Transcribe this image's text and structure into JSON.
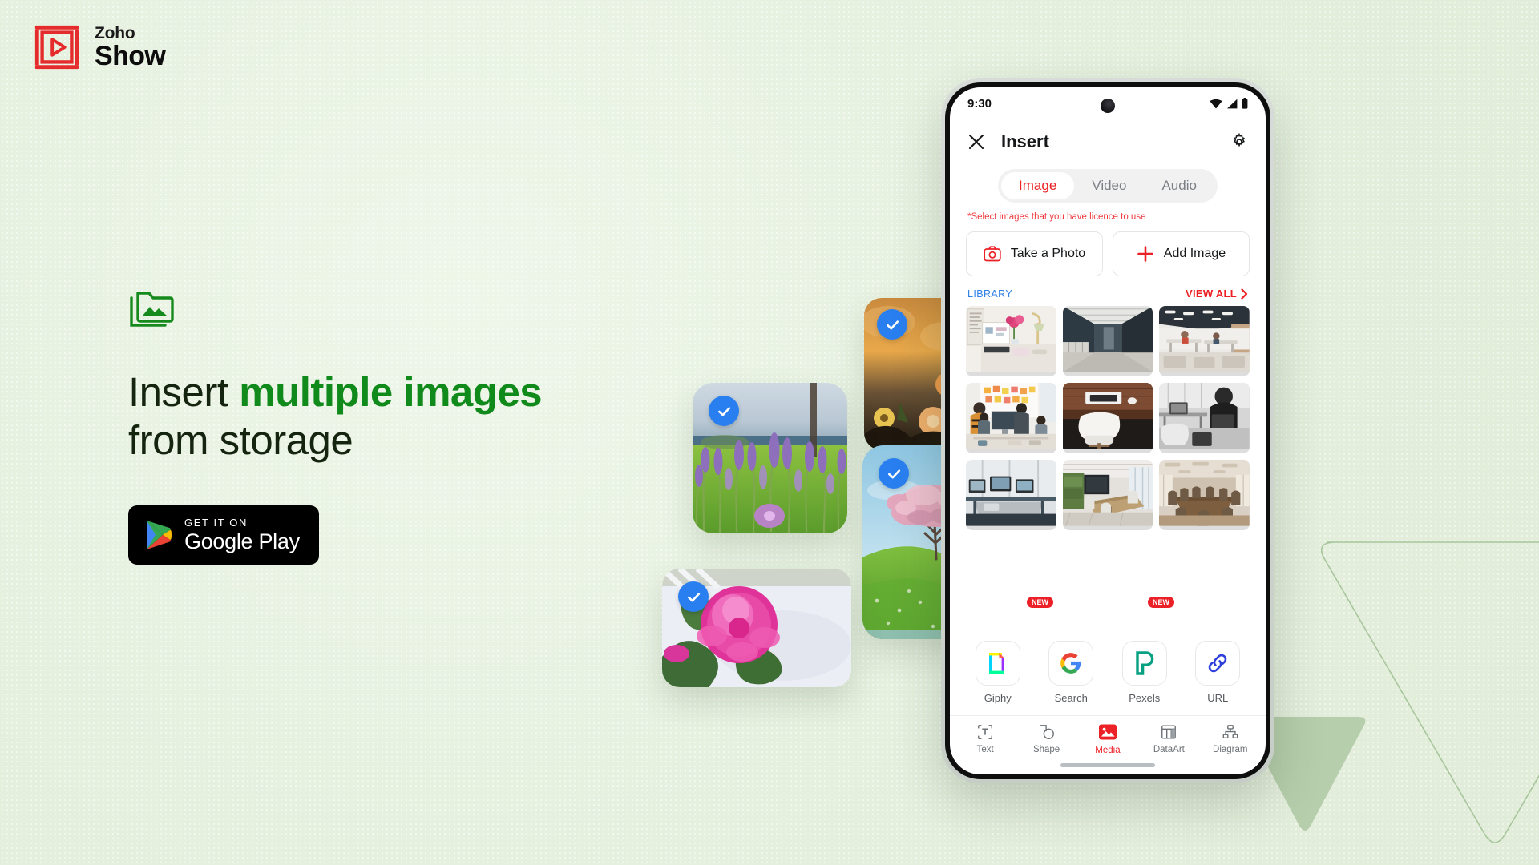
{
  "theme": {
    "background": "#e6f0e0",
    "accent_red": "#ed2024",
    "accent_green": "#118a1c",
    "select_blue": "#2a7ff0",
    "library_blue": "#2f7fe8"
  },
  "brand": {
    "logo_icon": "zoho-show-play-icon",
    "name_top": "Zoho",
    "name_bottom": "Show"
  },
  "hero": {
    "icon": "folder-image-icon",
    "headline_part1": "Insert ",
    "headline_strong": "multiple images",
    "headline_part2": "from storage",
    "cta": {
      "icon": "google-play-triangle-icon",
      "small_label": "GET IT ON",
      "big_label": "Google Play"
    }
  },
  "floating_cards": [
    {
      "id": "autumn",
      "name": "autumn-flowers-photo",
      "selected": true,
      "check_icon": "check-circle-icon"
    },
    {
      "id": "lavender",
      "name": "lavender-field-photo",
      "selected": true,
      "check_icon": "check-circle-icon"
    },
    {
      "id": "cherry",
      "name": "cherry-blossom-photo",
      "selected": true,
      "check_icon": "check-circle-icon"
    },
    {
      "id": "peony",
      "name": "pink-peony-photo",
      "selected": true,
      "check_icon": "check-circle-icon"
    }
  ],
  "phone": {
    "status": {
      "time": "9:30",
      "icons": [
        "wifi-icon",
        "signal-icon",
        "battery-icon"
      ]
    },
    "appbar": {
      "close_icon": "close-icon",
      "title": "Insert",
      "settings_icon": "gear-icon"
    },
    "tabs": [
      {
        "label": "Image",
        "active": true
      },
      {
        "label": "Video",
        "active": false
      },
      {
        "label": "Audio",
        "active": false
      }
    ],
    "notice": "*Select images that you have licence to use",
    "actions": [
      {
        "label": "Take a Photo",
        "icon": "camera-icon"
      },
      {
        "label": "Add Image",
        "icon": "plus-icon"
      }
    ],
    "library": {
      "label": "LIBRARY",
      "view_all_label": "VIEW ALL",
      "view_all_icon": "chevron-right-icon",
      "thumbnails": [
        "desk-with-laptop-and-flowers",
        "dark-office-corridor",
        "bright-open-plan-office",
        "team-workshop-sticky-notes",
        "white-chair-wooden-desk",
        "grayscale-coworking-desks",
        "desk-with-monitors-window",
        "green-meeting-room",
        "large-boardroom-table"
      ]
    },
    "sources": [
      {
        "label": "Giphy",
        "icon": "giphy-icon",
        "badge": "NEW"
      },
      {
        "label": "Search",
        "icon": "google-g-icon",
        "badge": ""
      },
      {
        "label": "Pexels",
        "icon": "pexels-icon",
        "badge": "NEW"
      },
      {
        "label": "URL",
        "icon": "link-icon",
        "badge": ""
      }
    ],
    "bottom_nav": [
      {
        "label": "Text",
        "icon": "text-box-icon",
        "active": false
      },
      {
        "label": "Shape",
        "icon": "shapes-icon",
        "active": false
      },
      {
        "label": "Media",
        "icon": "media-image-icon",
        "active": true
      },
      {
        "label": "DataArt",
        "icon": "table-chart-icon",
        "active": false
      },
      {
        "label": "Diagram",
        "icon": "org-diagram-icon",
        "active": false
      }
    ]
  },
  "decor": {
    "triangle_outline": "triangle-outline-shape",
    "triangle_filled": "triangle-filled-shape"
  }
}
